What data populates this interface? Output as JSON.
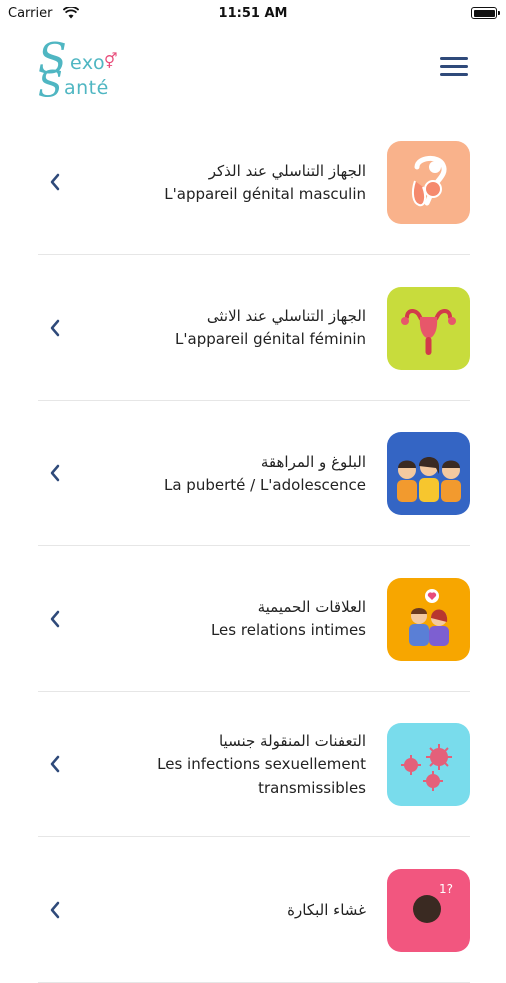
{
  "status_bar": {
    "carrier": "Carrier",
    "time": "11:51 AM"
  },
  "header": {
    "logo": {
      "line1": "exo",
      "line2": "anté",
      "letter": "S"
    },
    "menu_icon": "hamburger-menu-icon"
  },
  "colors": {
    "accent": "#4fb6c2",
    "logo_symbol": "#e84c7a",
    "menu": "#2f4a7a",
    "chevron": "#2f4a7a"
  },
  "categories": [
    {
      "ar": "الجهاز التناسلي عند الذكر",
      "fr": [
        "L'appareil génital masculin"
      ],
      "icon": "male-reproductive-icon",
      "icon_bg": "#f9b28b"
    },
    {
      "ar": "الجهاز التناسلي عند الانثى",
      "fr": [
        "L'appareil génital féminin"
      ],
      "icon": "female-reproductive-icon",
      "icon_bg": "#c8dc3c"
    },
    {
      "ar": "البلوغ و المراهقة",
      "fr": [
        "La puberté / L'adolescence"
      ],
      "icon": "teenagers-icon",
      "icon_bg": "#3465c4"
    },
    {
      "ar": "العلاقات الحميمية",
      "fr": [
        "Les relations intimes"
      ],
      "icon": "couple-icon",
      "icon_bg": "#f7a600"
    },
    {
      "ar": "التعفنات المنقولة جنسيا",
      "fr": [
        "Les infections sexuellement",
        "transmissibles"
      ],
      "icon": "virus-icon",
      "icon_bg": "#79dcec"
    },
    {
      "ar": "غشاء البكارة",
      "fr": [],
      "icon": "hymen-question-icon",
      "icon_bg": "#f2567f"
    }
  ]
}
